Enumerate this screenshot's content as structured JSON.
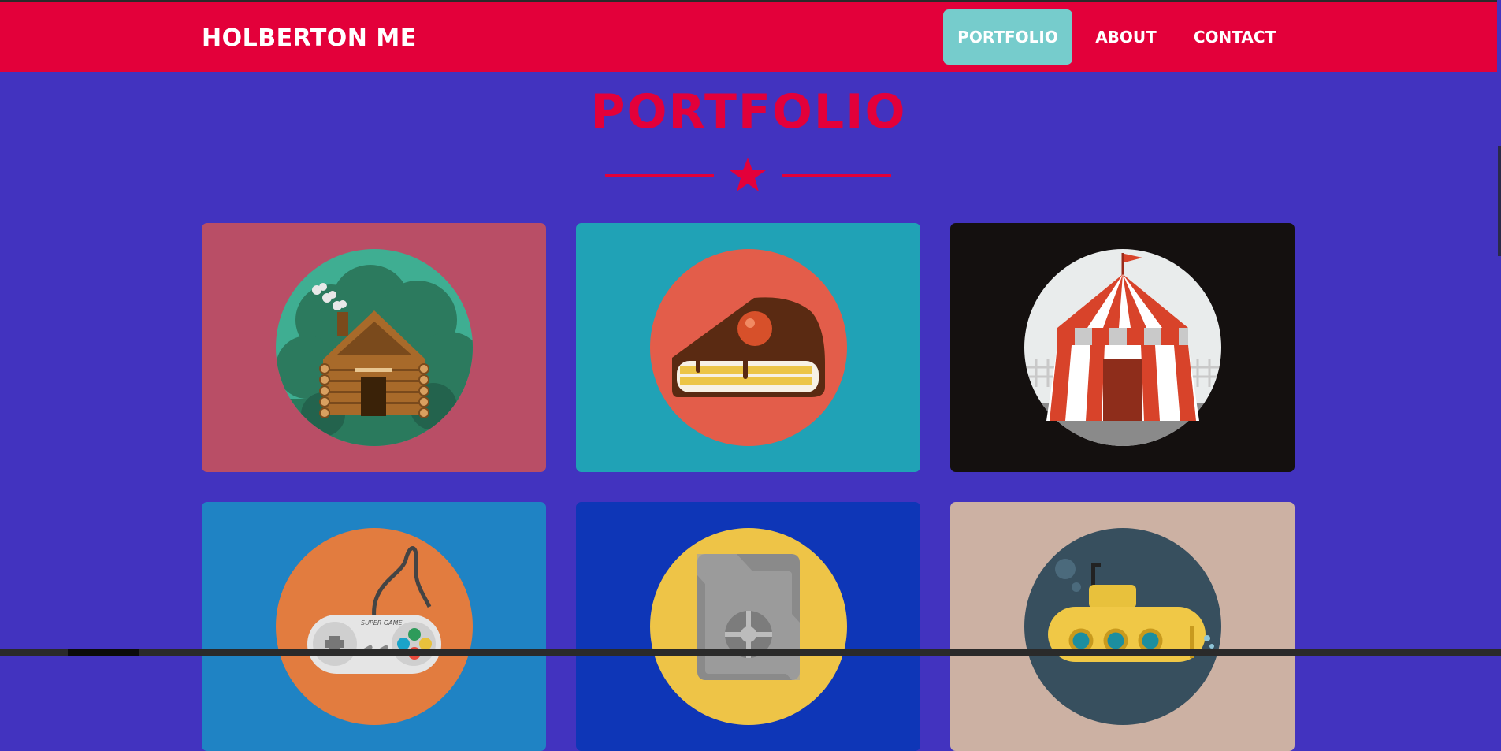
{
  "header": {
    "brand": "HOLBERTON ME",
    "nav": [
      {
        "label": "PORTFOLIO",
        "active": true
      },
      {
        "label": "ABOUT",
        "active": false
      },
      {
        "label": "CONTACT",
        "active": false
      }
    ]
  },
  "portfolio": {
    "title": "PORTFOLIO",
    "items": [
      {
        "icon": "log-cabin-icon",
        "bg": "#b94e66"
      },
      {
        "icon": "cake-slice-icon",
        "bg": "#20a2b6"
      },
      {
        "icon": "circus-tent-icon",
        "bg": "#14100f"
      },
      {
        "icon": "game-controller-icon",
        "bg": "#1f83c4",
        "text": "SUPER GAME"
      },
      {
        "icon": "safe-icon",
        "bg": "#0e36b7"
      },
      {
        "icon": "submarine-icon",
        "bg": "#ccb1a3"
      }
    ]
  },
  "colors": {
    "navbar": "#e3003a",
    "active_nav": "#76cccc",
    "page_bg": "#4233bf",
    "title": "#e3003a"
  }
}
